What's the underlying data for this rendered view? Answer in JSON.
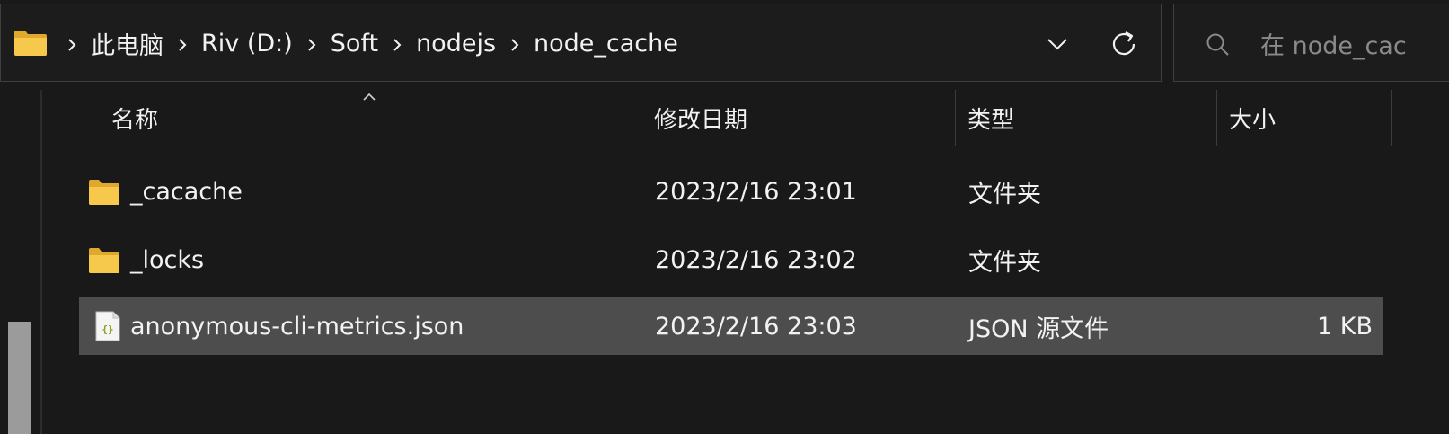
{
  "address_bar": {
    "breadcrumb": [
      "此电脑",
      "Riv (D:)",
      "Soft",
      "nodejs",
      "node_cache"
    ]
  },
  "search": {
    "placeholder": "在 node_cac"
  },
  "columns": {
    "name": "名称",
    "modified": "修改日期",
    "type": "类型",
    "size": "大小"
  },
  "files": [
    {
      "name": "_cacache",
      "modified": "2023/2/16 23:01",
      "type": "文件夹",
      "size": "",
      "icon": "folder-icon"
    },
    {
      "name": "_locks",
      "modified": "2023/2/16 23:02",
      "type": "文件夹",
      "size": "",
      "icon": "folder-icon"
    },
    {
      "name": "anonymous-cli-metrics.json",
      "modified": "2023/2/16 23:03",
      "type": "JSON 源文件",
      "size": "1 KB",
      "icon": "json-file-icon",
      "selected": true
    }
  ],
  "colors": {
    "background": "#191919",
    "selected_row": "#4d4d4d",
    "folder_yellow": "#f6c84c",
    "text": "#f2f2f2"
  }
}
